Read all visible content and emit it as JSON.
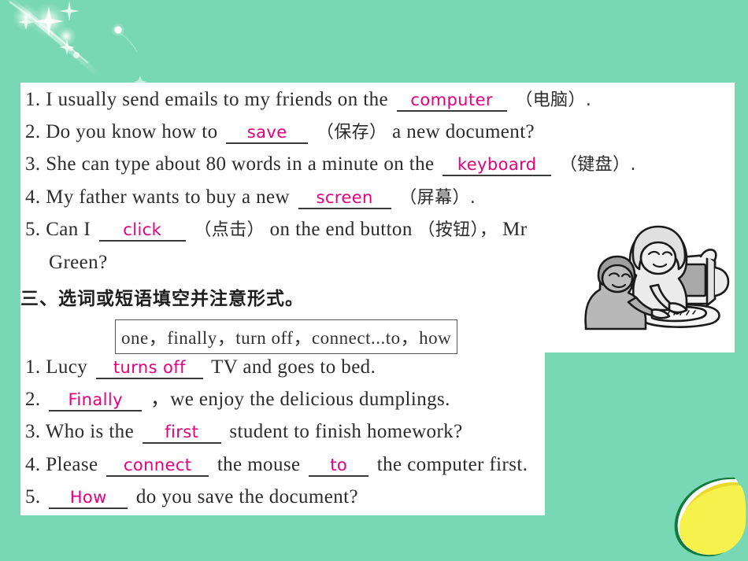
{
  "colors": {
    "background_teal": "#78d7b5",
    "sheet_white": "#ffffff",
    "answer_magenta": "#e5007e",
    "text_dark": "#2b2b2b",
    "leaf_yellow": "#f7f14e",
    "leaf_green": "#0f7a3d"
  },
  "section_a": {
    "items": [
      {
        "num": "1.",
        "before": "I usually send emails to my friends on the",
        "answer": "computer",
        "after_cn": "（电脑）.",
        "after_en": ""
      },
      {
        "num": "2.",
        "before": "Do you know how to",
        "answer": "save",
        "after_cn": "（保存）",
        "after_en": "a new document?"
      },
      {
        "num": "3.",
        "before": "She can type about 80 words in a minute on the",
        "answer": "keyboard",
        "after_cn": "（键盘）.",
        "after_en": ""
      },
      {
        "num": "4.",
        "before": "My father wants to buy a new",
        "answer": "screen",
        "after_cn": "（屏幕）.",
        "after_en": ""
      },
      {
        "num": "5.",
        "before": "Can I",
        "answer": "click",
        "after_cn": "（点击）",
        "after_en": "on the end button",
        "after_cn2": "（按钮），",
        "after_en2": "Mr",
        "wrap_line": "Green?"
      }
    ]
  },
  "section_b": {
    "heading": "三、选词或短语填空并注意形式。",
    "word_bank": "one，finally，turn off，connect...to，how",
    "items": [
      {
        "num": "1.",
        "before": "Lucy",
        "answer": "turns off",
        "after": "TV and goes to bed."
      },
      {
        "num": "2.",
        "before": "",
        "answer": "Finally",
        "after": "，we enjoy the delicious dumplings."
      },
      {
        "num": "3.",
        "before": "Who is the",
        "answer": "first",
        "after": "student to finish homework?"
      },
      {
        "num": "4.",
        "before": "Please",
        "answer": "connect",
        "mid": "the mouse",
        "answer2": "to",
        "after": "the computer first."
      },
      {
        "num": "5.",
        "before": "",
        "answer": "How",
        "after": "do you save the document?"
      }
    ]
  },
  "decorations": {
    "sparkle_name": "sparkle-star-decoration",
    "leaf_name": "yellow-leaf-decoration",
    "clipart_name": "two-people-at-computer-clipart"
  }
}
